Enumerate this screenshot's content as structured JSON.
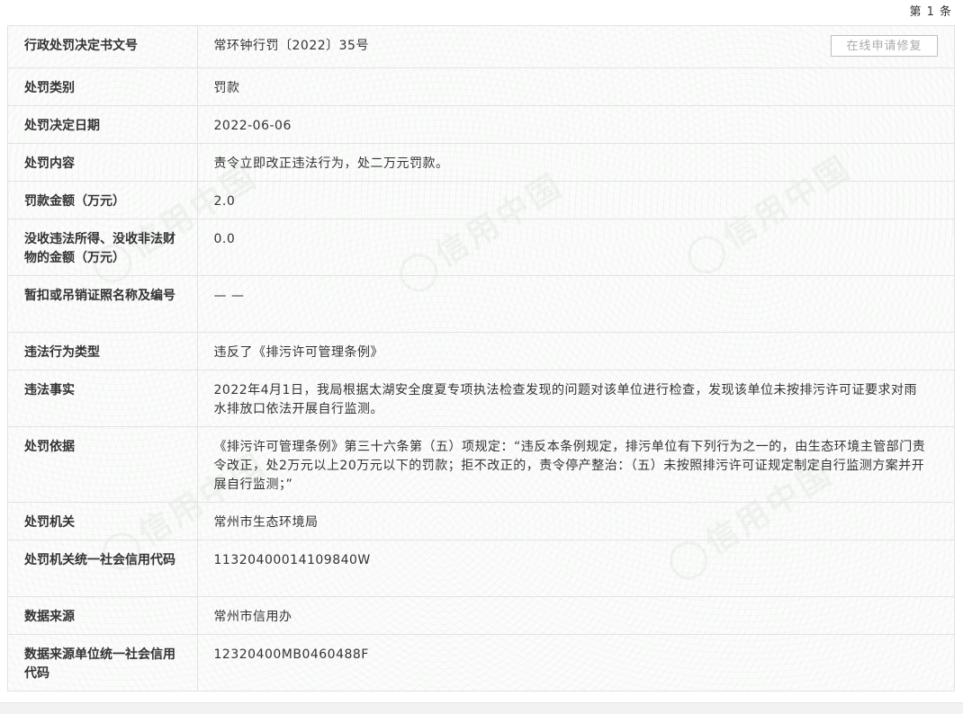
{
  "header": {
    "counter": "第 1 条"
  },
  "actions": {
    "repair_label": "在线申请修复"
  },
  "watermark": {
    "text": "信用中国"
  },
  "rows": [
    {
      "label": "行政处罚决定书文号",
      "value": "常环钟行罚〔2022〕35号"
    },
    {
      "label": "处罚类别",
      "value": "罚款"
    },
    {
      "label": "处罚决定日期",
      "value": "2022-06-06"
    },
    {
      "label": "处罚内容",
      "value": "责令立即改正违法行为，处二万元罚款。"
    },
    {
      "label": "罚款金额（万元）",
      "value": "2.0"
    },
    {
      "label": "没收违法所得、没收非法财物的金额（万元）",
      "value": "0.0"
    },
    {
      "label": "暂扣或吊销证照名称及编号",
      "value": "— —"
    },
    {
      "label": "违法行为类型",
      "value": "违反了《排污许可管理条例》"
    },
    {
      "label": "违法事实",
      "value": "2022年4月1日，我局根据太湖安全度夏专项执法检查发现的问题对该单位进行检查，发现该单位未按排污许可证要求对雨水排放口依法开展自行监测。"
    },
    {
      "label": "处罚依据",
      "value": "《排污许可管理条例》第三十六条第（五）项规定：“违反本条例规定，排污单位有下列行为之一的，由生态环境主管部门责令改正，处2万元以上20万元以下的罚款；拒不改正的，责令停产整治：（五）未按照排污许可证规定制定自行监测方案并开展自行监测；”"
    },
    {
      "label": "处罚机关",
      "value": "常州市生态环境局"
    },
    {
      "label": "处罚机关统一社会信用代码",
      "value": "11320400014109840W"
    },
    {
      "label": "数据来源",
      "value": "常州市信用办"
    },
    {
      "label": "数据来源单位统一社会信用代码",
      "value": "12320400MB0460488F"
    }
  ]
}
